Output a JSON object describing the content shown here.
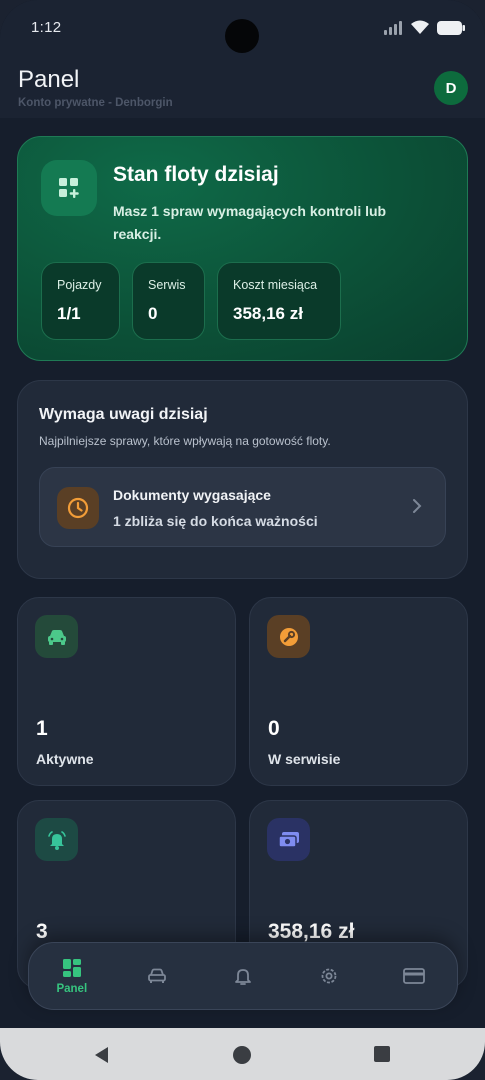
{
  "status_bar": {
    "time": "1:12"
  },
  "header": {
    "title": "Panel",
    "subtitle": "Konto prywatne - Denborgin",
    "avatar_letter": "D"
  },
  "hero": {
    "icon": "dashboard-add-icon",
    "title": "Stan floty dzisiaj",
    "description": "Masz 1 spraw wymagających kontroli lub reakcji.",
    "stats": [
      {
        "label": "Pojazdy",
        "value": "1/1"
      },
      {
        "label": "Serwis",
        "value": "0"
      },
      {
        "label": "Koszt miesiąca",
        "value": "358,16 zł"
      }
    ]
  },
  "attention": {
    "title": "Wymaga uwagi dzisiaj",
    "subtitle": "Najpilniejsze sprawy, które wpływają na gotowość floty.",
    "items": [
      {
        "icon": "clock-icon",
        "title": "Dokumenty wygasające",
        "subtitle": "1 zbliża się do końca ważności"
      }
    ]
  },
  "tiles": [
    {
      "icon": "car-icon",
      "value": "1",
      "label": "Aktywne",
      "icon_bg": "#244a3a",
      "icon_color": "#4cc98a"
    },
    {
      "icon": "wrench-icon",
      "value": "0",
      "label": "W serwisie",
      "icon_bg": "#5a3f25",
      "icon_color": "#f29d38"
    },
    {
      "icon": "alarm-bell-icon",
      "value": "3",
      "label": "",
      "icon_bg": "#1d4a44",
      "icon_color": "#37c49a"
    },
    {
      "icon": "money-icon",
      "value": "358,16 zł",
      "label": "",
      "icon_bg": "#2a3264",
      "icon_color": "#7f8cf0"
    }
  ],
  "bottom_nav": {
    "items": [
      {
        "icon": "dashboard-icon",
        "label": "Panel",
        "active": true
      },
      {
        "icon": "car-icon",
        "label": "",
        "active": false
      },
      {
        "icon": "bell-icon",
        "label": "",
        "active": false
      },
      {
        "icon": "gear-icon",
        "label": "",
        "active": false
      },
      {
        "icon": "credit-card-icon",
        "label": "",
        "active": false
      }
    ]
  },
  "colors": {
    "accent": "#36c47f",
    "background": "#161e2c",
    "card": "#212a39"
  }
}
